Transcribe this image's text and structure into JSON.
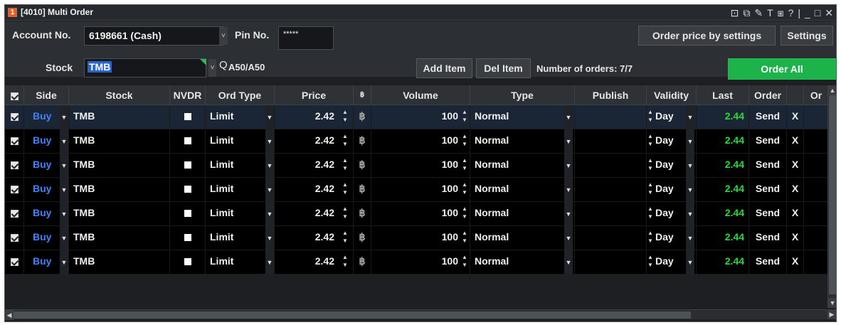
{
  "window": {
    "badge": "1",
    "title": "[4010] Multi Order",
    "controls": [
      "⊡",
      "⧉",
      "✎",
      "T",
      "⧆",
      "?",
      "|",
      "_",
      "□",
      "✕"
    ]
  },
  "toolbar": {
    "account_label": "Account No.",
    "account_value": "6198661 (Cash)",
    "pin_label": "Pin No.",
    "pin_value": "*****",
    "stock_label": "Stock",
    "stock_value": "TMB",
    "stock_info": "A50/A50",
    "order_price_btn": "Order price by settings",
    "settings_btn": "Settings",
    "add_item_btn": "Add Item",
    "del_item_btn": "Del Item",
    "orders_count": "Number of orders: 7/7",
    "order_all_btn": "Order All"
  },
  "grid": {
    "headers": {
      "side": "Side",
      "stock": "Stock",
      "nvdr": "NVDR",
      "ord_type": "Ord Type",
      "price": "Price",
      "b": "฿",
      "volume": "Volume",
      "type": "Type",
      "publish": "Publish",
      "validity": "Validity",
      "last": "Last",
      "order": "Order",
      "or": "Or"
    },
    "rows": [
      {
        "side": "Buy",
        "stock": "TMB",
        "ord_type": "Limit",
        "price": "2.42",
        "b": "฿",
        "volume": "100",
        "type": "Normal",
        "publish": "",
        "validity": "Day",
        "last": "2.44",
        "order": "Send",
        "x": "X"
      },
      {
        "side": "Buy",
        "stock": "TMB",
        "ord_type": "Limit",
        "price": "2.42",
        "b": "฿",
        "volume": "100",
        "type": "Normal",
        "publish": "",
        "validity": "Day",
        "last": "2.44",
        "order": "Send",
        "x": "X"
      },
      {
        "side": "Buy",
        "stock": "TMB",
        "ord_type": "Limit",
        "price": "2.42",
        "b": "฿",
        "volume": "100",
        "type": "Normal",
        "publish": "",
        "validity": "Day",
        "last": "2.44",
        "order": "Send",
        "x": "X"
      },
      {
        "side": "Buy",
        "stock": "TMB",
        "ord_type": "Limit",
        "price": "2.42",
        "b": "฿",
        "volume": "100",
        "type": "Normal",
        "publish": "",
        "validity": "Day",
        "last": "2.44",
        "order": "Send",
        "x": "X"
      },
      {
        "side": "Buy",
        "stock": "TMB",
        "ord_type": "Limit",
        "price": "2.42",
        "b": "฿",
        "volume": "100",
        "type": "Normal",
        "publish": "",
        "validity": "Day",
        "last": "2.44",
        "order": "Send",
        "x": "X"
      },
      {
        "side": "Buy",
        "stock": "TMB",
        "ord_type": "Limit",
        "price": "2.42",
        "b": "฿",
        "volume": "100",
        "type": "Normal",
        "publish": "",
        "validity": "Day",
        "last": "2.44",
        "order": "Send",
        "x": "X"
      },
      {
        "side": "Buy",
        "stock": "TMB",
        "ord_type": "Limit",
        "price": "2.42",
        "b": "฿",
        "volume": "100",
        "type": "Normal",
        "publish": "",
        "validity": "Day",
        "last": "2.44",
        "order": "Send",
        "x": "X"
      }
    ]
  },
  "colors": {
    "buy": "#3f82ff",
    "last_up": "#22dd33",
    "order_all": "#1bb34a"
  }
}
